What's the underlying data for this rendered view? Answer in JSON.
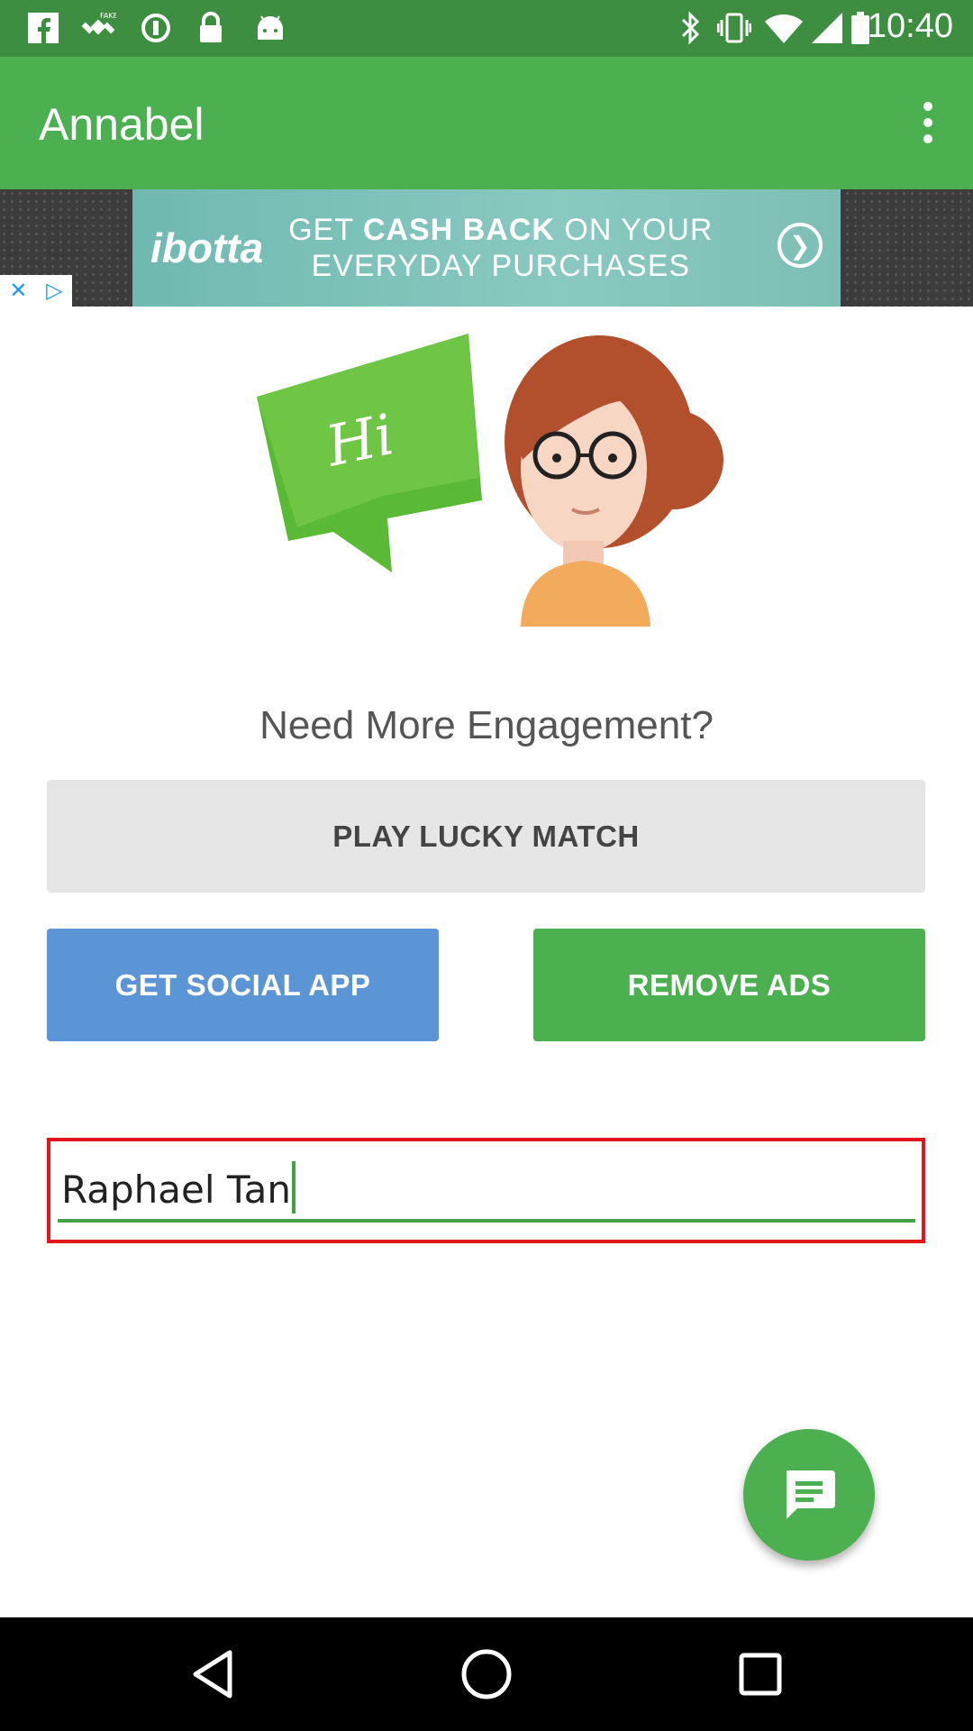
{
  "status_bar": {
    "time": "10:40",
    "left_icons": [
      "facebook-icon",
      "fake-gps-icon",
      "sync-icon",
      "lock-icon",
      "android-icon"
    ],
    "right_icons": [
      "bluetooth-icon",
      "vibrate-icon",
      "wifi-icon",
      "signal-icon",
      "battery-icon"
    ]
  },
  "app_bar": {
    "title": "Annabel",
    "menu_icon": "more-vert-icon"
  },
  "ad": {
    "brand": "ibotta",
    "line1_pre": "GET ",
    "line1_bold": "CASH BACK",
    "line1_post": " ON YOUR",
    "line2": "EVERYDAY PURCHASES"
  },
  "hero": {
    "bubble_text": "Hi"
  },
  "main": {
    "headline": "Need More Engagement?",
    "play_button": "PLAY LUCKY MATCH",
    "social_button": "GET SOCIAL APP",
    "remove_ads_button": "REMOVE ADS",
    "name_input_value": "Raphael Tan"
  },
  "fab": {
    "icon": "chat-icon"
  },
  "nav": {
    "icons": [
      "back-icon",
      "home-icon",
      "recents-icon"
    ]
  },
  "colors": {
    "status_bar": "#3d8e40",
    "app_bar": "#4caf50",
    "social_button": "#5b95d6",
    "remove_ads_button": "#4caf50",
    "input_highlight": "#e0171b"
  }
}
